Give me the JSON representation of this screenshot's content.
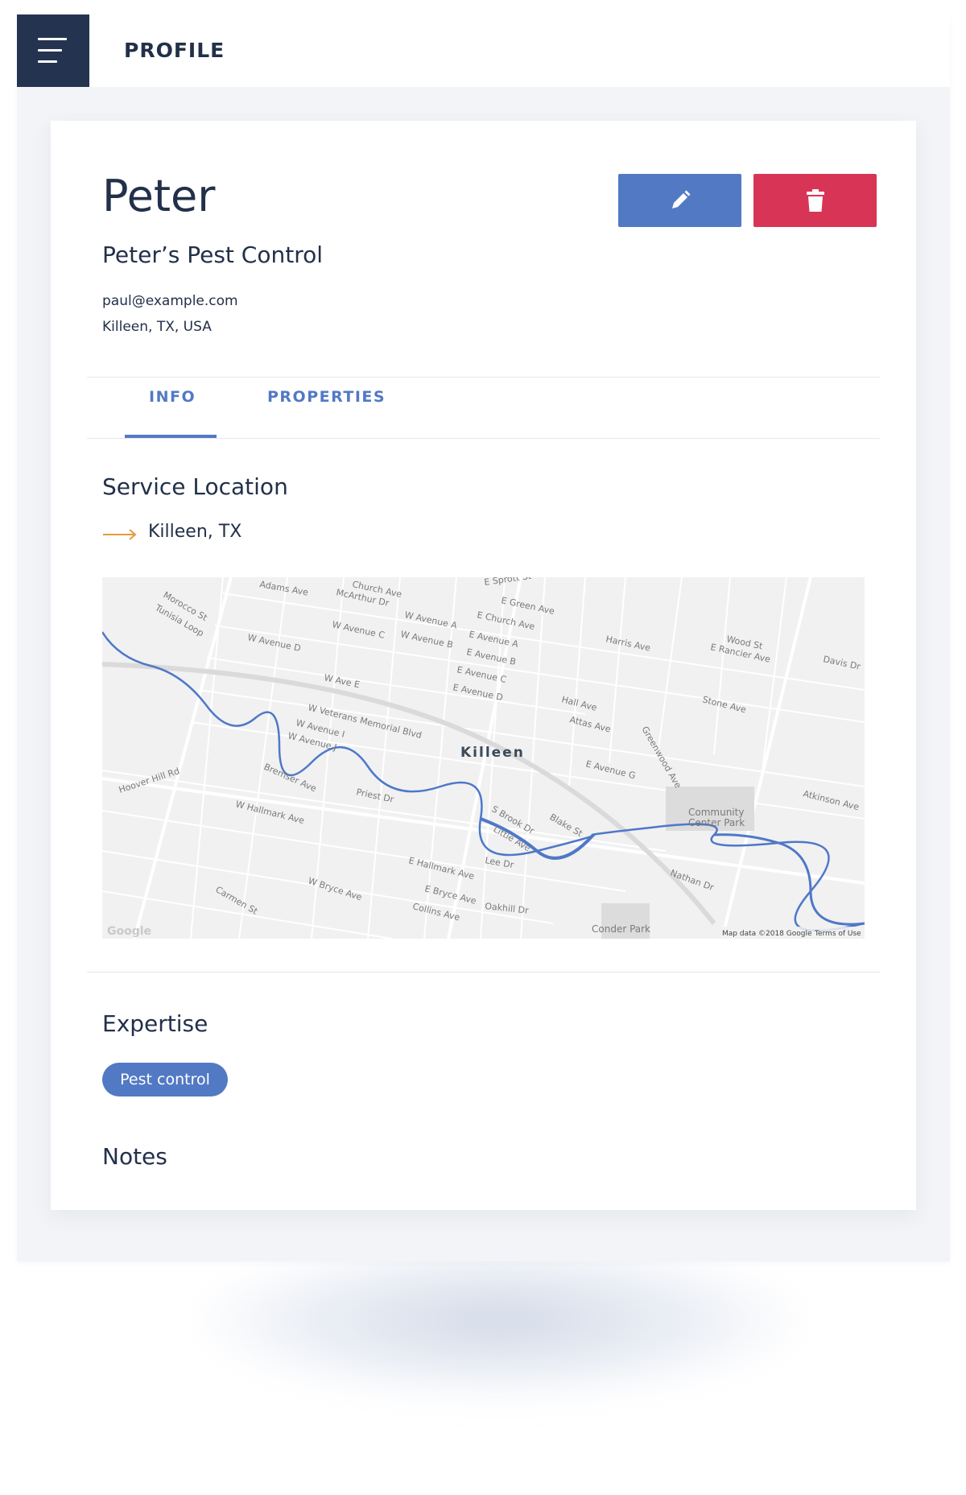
{
  "header": {
    "title": "PROFILE",
    "menu_icon": "hamburger-menu-icon"
  },
  "profile": {
    "name": "Peter",
    "company": "Peter’s Pest Control",
    "email": "paul@example.com",
    "address": "Killeen, TX, USA"
  },
  "actions": {
    "edit_icon": "pencil-icon",
    "delete_icon": "trash-icon",
    "edit_color": "#5279c4",
    "delete_color": "#d83556"
  },
  "tabs": [
    {
      "label": "INFO",
      "active": true
    },
    {
      "label": "PROPERTIES",
      "active": false
    }
  ],
  "service_location": {
    "title": "Service Location",
    "value": "Killeen, TX",
    "icon": "arrow-right-icon"
  },
  "map": {
    "city_label": "Killeen",
    "attribution": "Map data ©2018 Google",
    "terms": "Terms of Use",
    "logo": "Google",
    "park_label_line1": "Community",
    "park_label_line2": "Center Park",
    "conder_park": "Conder Park",
    "street_labels": [
      "Adams Ave",
      "Church Ave",
      "McArthur Dr",
      "Morocco St",
      "Tunisia Loop",
      "W Avenue C",
      "W Avenue D",
      "W Avenue A",
      "W Avenue B",
      "E Church Ave",
      "E Avenue A",
      "E Avenue B",
      "E Avenue C",
      "E Avenue D",
      "E Green Ave",
      "E Sprott St",
      "Harris Ave",
      "Wood St",
      "E Rancier Ave",
      "Davis Dr",
      "W Ave E",
      "W Veterans Memorial Blvd",
      "W Avenue I",
      "W Avenue J",
      "Bremser Ave",
      "Priest Dr",
      "W Hallmark Ave",
      "E Hallmark Ave",
      "W Bryce Ave",
      "E Bryce Ave",
      "Collins Ave",
      "Carmen St",
      "Hoover Hill Rd",
      "Hall Ave",
      "Attas Ave",
      "Stone Ave",
      "Atkinson Ave",
      "E Avenue G",
      "Nathan Dr",
      "Lee Dr",
      "Little Ave",
      "Blake St",
      "S Brook Dr",
      "Oakhill Dr",
      "Greenwood Ave"
    ]
  }
}
